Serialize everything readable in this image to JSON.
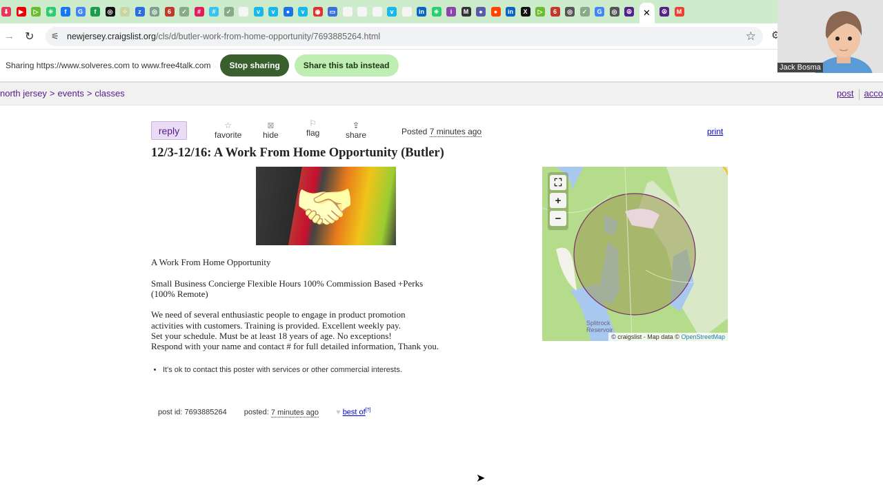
{
  "browser": {
    "bookmarks": [
      {
        "icon": "pocket-icon",
        "color": "#e8355b",
        "glyph": "⬇"
      },
      {
        "icon": "youtube-icon",
        "color": "#e00",
        "glyph": "▶"
      },
      {
        "icon": "rumble-icon",
        "color": "#6dbb2e",
        "glyph": "▷"
      },
      {
        "icon": "asterisk-icon",
        "color": "#2ecc71",
        "glyph": "✳"
      },
      {
        "icon": "facebook-icon",
        "color": "#1877f2",
        "glyph": "f"
      },
      {
        "icon": "google-icon",
        "color": "#4285f4",
        "glyph": "G"
      },
      {
        "icon": "green-circle-icon",
        "color": "#1e9b4a",
        "glyph": "f"
      },
      {
        "icon": "openai-icon",
        "color": "#111",
        "glyph": "◎"
      },
      {
        "icon": "dots-icon",
        "color": "#c9d6a3",
        "glyph": "⁘"
      },
      {
        "icon": "zoom-icon",
        "color": "#2d6cdf",
        "glyph": "z"
      },
      {
        "icon": "chatgpt-icon",
        "color": "#7fa08f",
        "glyph": "◎"
      },
      {
        "icon": "badge-625-icon",
        "color": "#c0392b",
        "glyph": "6"
      },
      {
        "icon": "check-icon",
        "color": "#8a8",
        "glyph": "✓"
      },
      {
        "icon": "slack-icon",
        "color": "#e01e5a",
        "glyph": "#"
      },
      {
        "icon": "slack-icon",
        "color": "#36c5f0",
        "glyph": "#"
      },
      {
        "icon": "check-icon",
        "color": "#8a8",
        "glyph": "✓"
      },
      {
        "icon": "blank-icon",
        "color": "#f5f5f5",
        "glyph": ""
      },
      {
        "icon": "vimeo-icon",
        "color": "#1ab7ea",
        "glyph": "v"
      },
      {
        "icon": "vimeo-icon",
        "color": "#1ab7ea",
        "glyph": "v"
      },
      {
        "icon": "blue-circle-icon",
        "color": "#1a73e8",
        "glyph": "●"
      },
      {
        "icon": "vimeo-icon",
        "color": "#1ab7ea",
        "glyph": "v"
      },
      {
        "icon": "record-icon",
        "color": "#d33",
        "glyph": "◉"
      },
      {
        "icon": "screen-icon",
        "color": "#3b6fd8",
        "glyph": "▭"
      },
      {
        "icon": "blank-icon",
        "color": "#f5f5f5",
        "glyph": ""
      },
      {
        "icon": "blank-icon",
        "color": "#f5f5f5",
        "glyph": ""
      },
      {
        "icon": "blank-icon",
        "color": "#f5f5f5",
        "glyph": ""
      },
      {
        "icon": "vimeo-icon",
        "color": "#1ab7ea",
        "glyph": "v"
      },
      {
        "icon": "blank-icon",
        "color": "#f5f5f5",
        "glyph": ""
      },
      {
        "icon": "linkedin-icon",
        "color": "#0a66c2",
        "glyph": "in"
      },
      {
        "icon": "asterisk-icon",
        "color": "#2ecc71",
        "glyph": "✳"
      },
      {
        "icon": "info-icon",
        "color": "#8e44ad",
        "glyph": "i"
      },
      {
        "icon": "gmail-icon",
        "color": "#333",
        "glyph": "M"
      },
      {
        "icon": "generic-icon",
        "color": "#5a5aa8",
        "glyph": "●"
      },
      {
        "icon": "reddit-icon",
        "color": "#ff4500",
        "glyph": "●"
      },
      {
        "icon": "linkedin-icon",
        "color": "#0a66c2",
        "glyph": "in"
      },
      {
        "icon": "x-icon",
        "color": "#111",
        "glyph": "X"
      },
      {
        "icon": "rumble-icon",
        "color": "#6dbb2e",
        "glyph": "▷"
      },
      {
        "icon": "badge-625-icon",
        "color": "#c0392b",
        "glyph": "6"
      },
      {
        "icon": "chrome-icon",
        "color": "#555",
        "glyph": "◎"
      },
      {
        "icon": "check-icon",
        "color": "#8a8",
        "glyph": "✓"
      },
      {
        "icon": "google-icon",
        "color": "#4285f4",
        "glyph": "G"
      },
      {
        "icon": "chrome-icon",
        "color": "#555",
        "glyph": "◎"
      },
      {
        "icon": "peace-icon",
        "color": "#552288",
        "glyph": "☮"
      }
    ],
    "active_tab_close": "✕",
    "after_tabs": [
      {
        "icon": "peace-icon",
        "color": "#552288",
        "glyph": "☮"
      },
      {
        "icon": "gmail-icon",
        "color": "#ea4335",
        "glyph": "M"
      }
    ],
    "url_host": "newjersey.craigslist.org",
    "url_path": "/cls/d/butler-work-from-home-opportunity/7693885264.html"
  },
  "sharing": {
    "text": "Sharing https://www.solveres.com to www.free4talk.com",
    "stop_label": "Stop sharing",
    "share_tab_label": "Share this tab instead"
  },
  "webcam": {
    "name": "Jack Bosma"
  },
  "breadcrumbs": [
    "north jersey",
    "events",
    "classes"
  ],
  "crumb_sep": ">",
  "top_links": {
    "post": "post",
    "account": "acco"
  },
  "post": {
    "actions": {
      "reply": "reply",
      "favorite": "favorite",
      "hide": "hide",
      "flag": "flag",
      "share": "share"
    },
    "posted_label": "Posted",
    "posted_time": "7 minutes ago",
    "print": "print",
    "title": "12/3-12/16: A Work From Home Opportunity (Butler)",
    "body": [
      [
        "A Work From Home Opportunity"
      ],
      [
        "Small Business Concierge Flexible Hours 100% Commission Based +Perks",
        "(100% Remote)"
      ],
      [
        "We need of several enthusiastic people to engage in product promotion",
        "activities with customers. Training is provided. Excellent weekly pay.",
        "Set your schedule. Must be at least 18 years of age. No exceptions!",
        "Respond with your name and contact # for full detailed information, Thank you."
      ]
    ],
    "notice": "It's ok to contact this poster with services or other commercial interests.",
    "footer": {
      "post_id": "post id: 7693885264",
      "posted_label": "posted:",
      "posted_time": "7 minutes ago",
      "best_of": "best of",
      "best_of_sup": "[?]"
    }
  },
  "map": {
    "place_label_1": "Splitrock",
    "place_label_2": "Reservoir",
    "attribution": "© craigslist - Map data ©",
    "osm": "OpenStreetMap",
    "colors": {
      "land": "#b5dc8a",
      "water": "#a9c8f0",
      "circle_stroke": "#7a2c6e",
      "circle_fill": "#9a9a55"
    }
  }
}
